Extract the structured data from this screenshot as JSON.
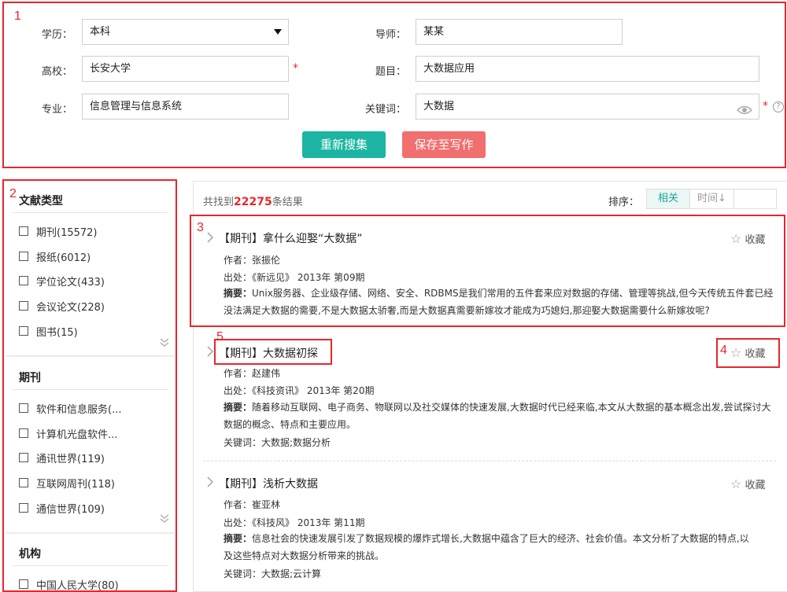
{
  "annotations": [
    "1",
    "2",
    "3",
    "4",
    "5"
  ],
  "form": {
    "education_label": "学历：",
    "education_value": "本科",
    "advisor_label": "导师：",
    "advisor_value": "某某",
    "school_label": "高校：",
    "school_value": "长安大学",
    "topic_label": "题目：",
    "topic_value": "大数据应用",
    "major_label": "专业：",
    "major_value": "信息管理与信息系统",
    "keyword_label": "关键词：",
    "keyword_value": "大数据",
    "required_mark": "*",
    "help_mark": "?",
    "research_button": "重新搜集",
    "save_button": "保存至写作",
    "colors": {
      "research": "#1cb5a3",
      "save": "#f26f6f",
      "annotation": "#e8262d"
    }
  },
  "sidebar": {
    "sections": [
      {
        "title": "文献类型",
        "items": [
          "期刊(15572)",
          "报纸(6012)",
          "学位论文(433)",
          "会议论文(228)",
          "图书(15)"
        ]
      },
      {
        "title": "期刊",
        "items": [
          "软件和信息服务(...",
          "计算机光盘软件...",
          "通讯世界(119)",
          "互联网周刊(118)",
          "通信世界(109)"
        ]
      },
      {
        "title": "机构",
        "items": [
          "中国人民大学(80)"
        ]
      }
    ]
  },
  "results": {
    "count_prefix": "共找到",
    "count": "22275",
    "count_suffix": "条结果",
    "sort_label": "排序：",
    "sort_options": [
      "相关",
      "时间↓"
    ],
    "sort_active": "相关",
    "fav_label": "收藏",
    "author_label": "作者：",
    "source_label": "出处：",
    "abstract_label": "摘要：",
    "keywords_label": "关键词：",
    "items": [
      {
        "title": "【期刊】拿什么迎娶“大数据”",
        "author": "张振伦",
        "source": "《新远见》 2013年 第09期",
        "abstract_line1": "Unix服务器、企业级存储、网络、安全、RDBMS是我们常用的五件套来应对数据的存储、管理等挑战,但今天传统五件套已经",
        "abstract_line2": "没法满足大数据的需要,不是大数据太骄奢,而是大数据真需要新嫁妆才能成为巧媳妇,那迎娶大数据需要什么新嫁妆呢?"
      },
      {
        "title": "【期刊】大数据初探",
        "author": "赵建伟",
        "source": "《科技资讯》 2013年 第20期",
        "abstract_line1": "随着移动互联网、电子商务、物联网以及社交媒体的快速发展,大数据时代已经来临,本文从大数据的基本概念出发,尝试探讨大",
        "abstract_line2": "数据的概念、特点和主要应用。",
        "keywords": "大数据;数据分析"
      },
      {
        "title": "【期刊】浅析大数据",
        "author": "崔亚林",
        "source": "《科技风》 2013年 第11期",
        "abstract_line1": "信息社会的快速发展引发了数据规模的爆炸式增长,大数据中蕴含了巨大的经济、社会价值。本文分析了大数据的特点,以",
        "abstract_line2": "及这些特点对大数据分析带来的挑战。",
        "keywords": "大数据;云计算"
      }
    ]
  }
}
